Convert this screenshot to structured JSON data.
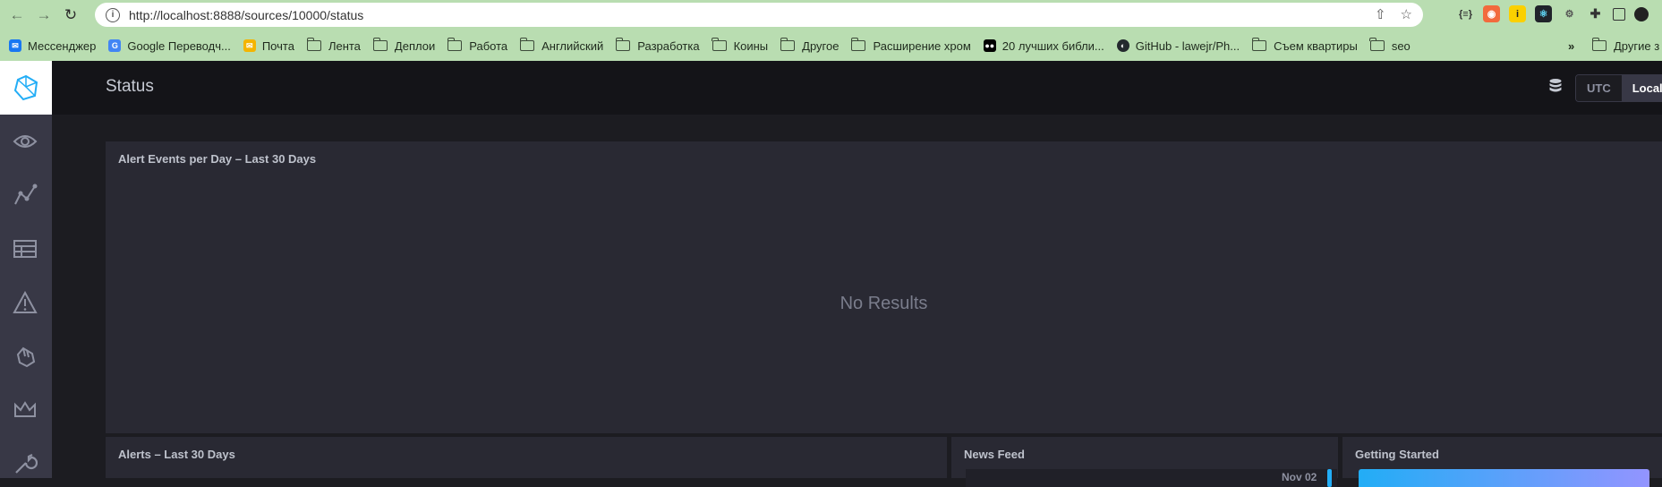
{
  "browser": {
    "url": "http://localhost:8888/sources/10000/status",
    "bookmarks": [
      {
        "label": "Мессенджер",
        "icon": "messenger-icon",
        "color": "#1877f2"
      },
      {
        "label": "Google Переводч...",
        "icon": "google-translate-icon",
        "color": "#4285f4"
      },
      {
        "label": "Почта",
        "icon": "mail-icon",
        "color": "#f4b400"
      },
      {
        "label": "Лента",
        "icon": "folder-icon"
      },
      {
        "label": "Деплои",
        "icon": "folder-icon"
      },
      {
        "label": "Работа",
        "icon": "folder-icon"
      },
      {
        "label": "Английский",
        "icon": "folder-icon"
      },
      {
        "label": "Разработка",
        "icon": "folder-icon"
      },
      {
        "label": "Коины",
        "icon": "folder-icon"
      },
      {
        "label": "Другое",
        "icon": "folder-icon"
      },
      {
        "label": "Расширение хром",
        "icon": "folder-icon"
      },
      {
        "label": "20 лучших библи...",
        "icon": "medium-icon",
        "color": "#000000"
      },
      {
        "label": "GitHub - lawejr/Ph...",
        "icon": "github-icon",
        "color": "#24292e"
      },
      {
        "label": "Съем квартиры",
        "icon": "folder-icon"
      },
      {
        "label": "seo",
        "icon": "folder-icon"
      }
    ],
    "more_bookmarks": "»",
    "other_bookmarks": "Другие з"
  },
  "sidebar": {
    "items": [
      {
        "name": "host-list",
        "icon": "eye-icon"
      },
      {
        "name": "data-explorer",
        "icon": "graph-icon"
      },
      {
        "name": "dashboards",
        "icon": "dashboard-grid-icon"
      },
      {
        "name": "alerting",
        "icon": "alert-triangle-icon"
      },
      {
        "name": "log-viewer",
        "icon": "wizard-hand-icon"
      },
      {
        "name": "admin",
        "icon": "crown-icon"
      },
      {
        "name": "configuration",
        "icon": "wrench-icon"
      }
    ]
  },
  "header": {
    "title": "Status",
    "timezone": {
      "options": [
        "UTC",
        "Local"
      ],
      "selected": "Local"
    }
  },
  "cells": {
    "alert_events": {
      "title": "Alert Events per Day – Last 30 Days",
      "empty_text": "No Results"
    },
    "alerts": {
      "title": "Alerts – Last 30 Days"
    },
    "news_feed": {
      "title": "News Feed",
      "first_date": "Nov 02"
    },
    "getting_started": {
      "title": "Getting Started"
    }
  },
  "colors": {
    "accent": "#22adf6",
    "background": "#1c1c21",
    "cell": "#292933",
    "sidebar": "#383846"
  }
}
